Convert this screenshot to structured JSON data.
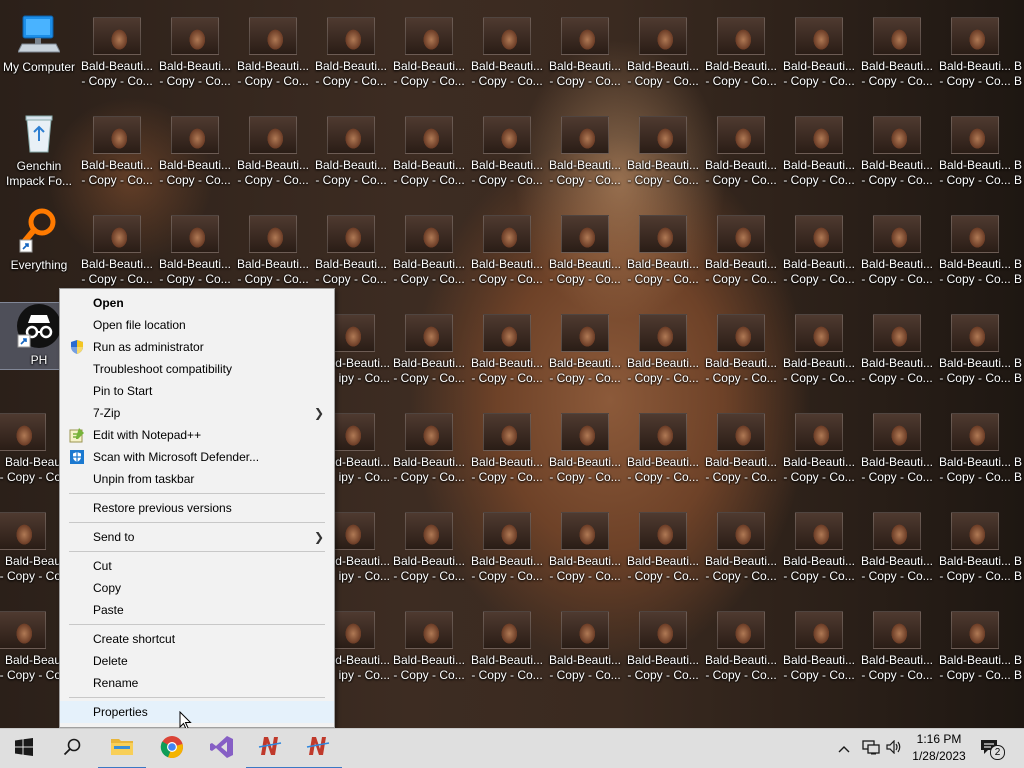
{
  "desktop": {
    "my_computer": {
      "label": "My Computer"
    },
    "recycle": {
      "line1": "Genchin",
      "line2": "Impack Fo..."
    },
    "everything": {
      "label": "Everything"
    },
    "ph": {
      "label": "PH"
    },
    "file_label_line1": "Bald-Beauti...",
    "file_label_line1_cut": "Bald-Beau",
    "file_label_line2": "- Copy - Co...",
    "file_label_line2_cut": "- Copy - Co",
    "file_label_left_cut": "ipy - Co...",
    "file_label_edge_cut": "B"
  },
  "context_menu": {
    "items": [
      {
        "label": "Open",
        "bold": true
      },
      {
        "label": "Open file location"
      },
      {
        "label": "Run as administrator",
        "icon": "shield-icon"
      },
      {
        "label": "Troubleshoot compatibility"
      },
      {
        "label": "Pin to Start"
      },
      {
        "label": "7-Zip",
        "submenu": true
      },
      {
        "label": "Edit with Notepad++",
        "icon": "notepadpp-icon"
      },
      {
        "label": "Scan with Microsoft Defender...",
        "icon": "defender-icon"
      },
      {
        "label": "Unpin from taskbar"
      },
      {
        "label": "Restore previous versions"
      },
      {
        "label": "Send to",
        "submenu": true
      },
      {
        "label": "Cut"
      },
      {
        "label": "Copy"
      },
      {
        "label": "Paste"
      },
      {
        "label": "Create shortcut"
      },
      {
        "label": "Delete"
      },
      {
        "label": "Rename"
      },
      {
        "label": "Properties",
        "highlighted": true
      }
    ]
  },
  "taskbar": {
    "apps": [
      "start-icon",
      "search-icon",
      "file-explorer-icon",
      "chrome-icon",
      "visual-studio-icon",
      "ndm-icon",
      "ndm-icon"
    ],
    "time": "1:16 PM",
    "date": "1/28/2023",
    "notification_count": "2"
  },
  "colors": {
    "taskbar_bg": "#dfdfdf",
    "menu_bg": "#f2f2f2",
    "menu_highlight": "#e5f1fb",
    "selection": "#aac8ff"
  }
}
